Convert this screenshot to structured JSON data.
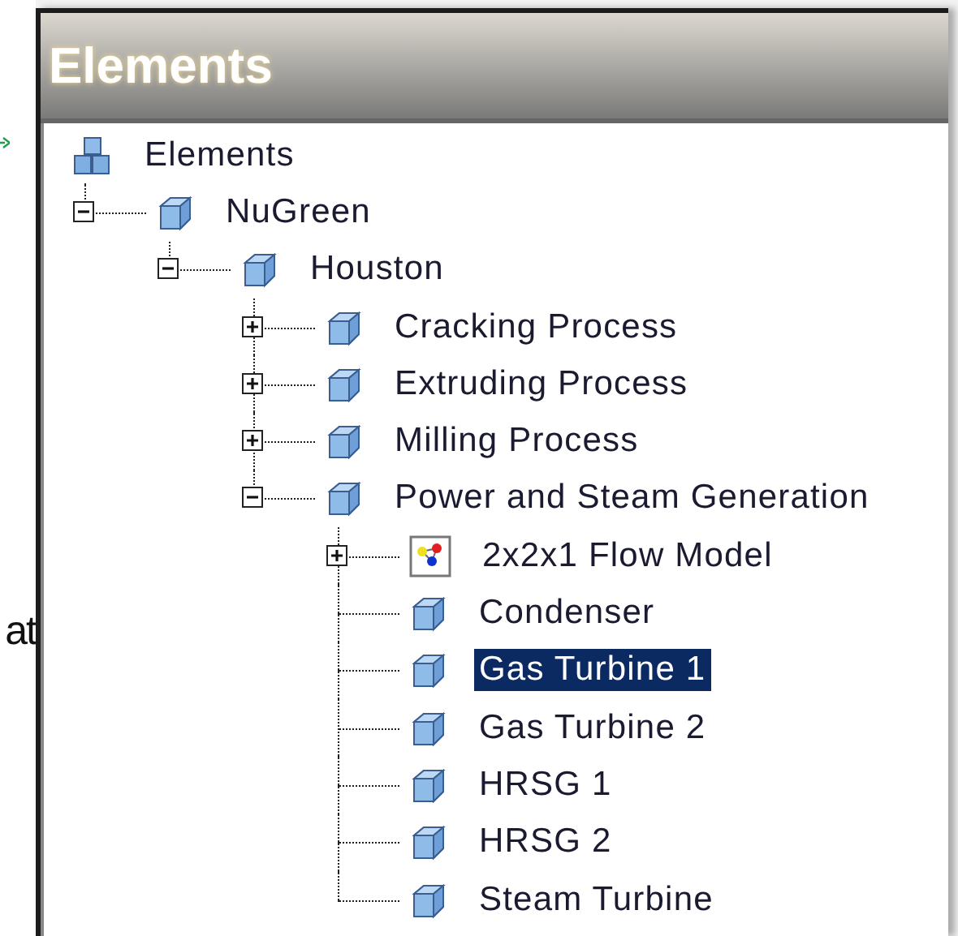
{
  "background_text": "at",
  "panel": {
    "title": "Elements"
  },
  "tree": [
    {
      "label": "Elements",
      "kind": "root",
      "selected": false,
      "children": [
        {
          "label": "NuGreen",
          "kind": "element",
          "selected": false,
          "expanded": true,
          "children": [
            {
              "label": "Houston",
              "kind": "element",
              "selected": false,
              "expanded": true,
              "children": [
                {
                  "label": "Cracking Process",
                  "kind": "element",
                  "selected": false,
                  "expanded": false
                },
                {
                  "label": "Extruding Process",
                  "kind": "element",
                  "selected": false,
                  "expanded": false
                },
                {
                  "label": "Milling Process",
                  "kind": "element",
                  "selected": false,
                  "expanded": false
                },
                {
                  "label": "Power and Steam Generation",
                  "kind": "element",
                  "selected": false,
                  "expanded": true,
                  "children": [
                    {
                      "label": "2x2x1 Flow Model",
                      "kind": "model",
                      "selected": false,
                      "expanded": false
                    },
                    {
                      "label": "Condenser",
                      "kind": "element",
                      "selected": false
                    },
                    {
                      "label": "Gas Turbine 1",
                      "kind": "element",
                      "selected": true
                    },
                    {
                      "label": "Gas Turbine 2",
                      "kind": "element",
                      "selected": false
                    },
                    {
                      "label": "HRSG 1",
                      "kind": "element",
                      "selected": false
                    },
                    {
                      "label": "HRSG 2",
                      "kind": "element",
                      "selected": false
                    },
                    {
                      "label": "Steam Turbine",
                      "kind": "element",
                      "selected": false
                    }
                  ]
                }
              ]
            }
          ]
        }
      ]
    }
  ]
}
